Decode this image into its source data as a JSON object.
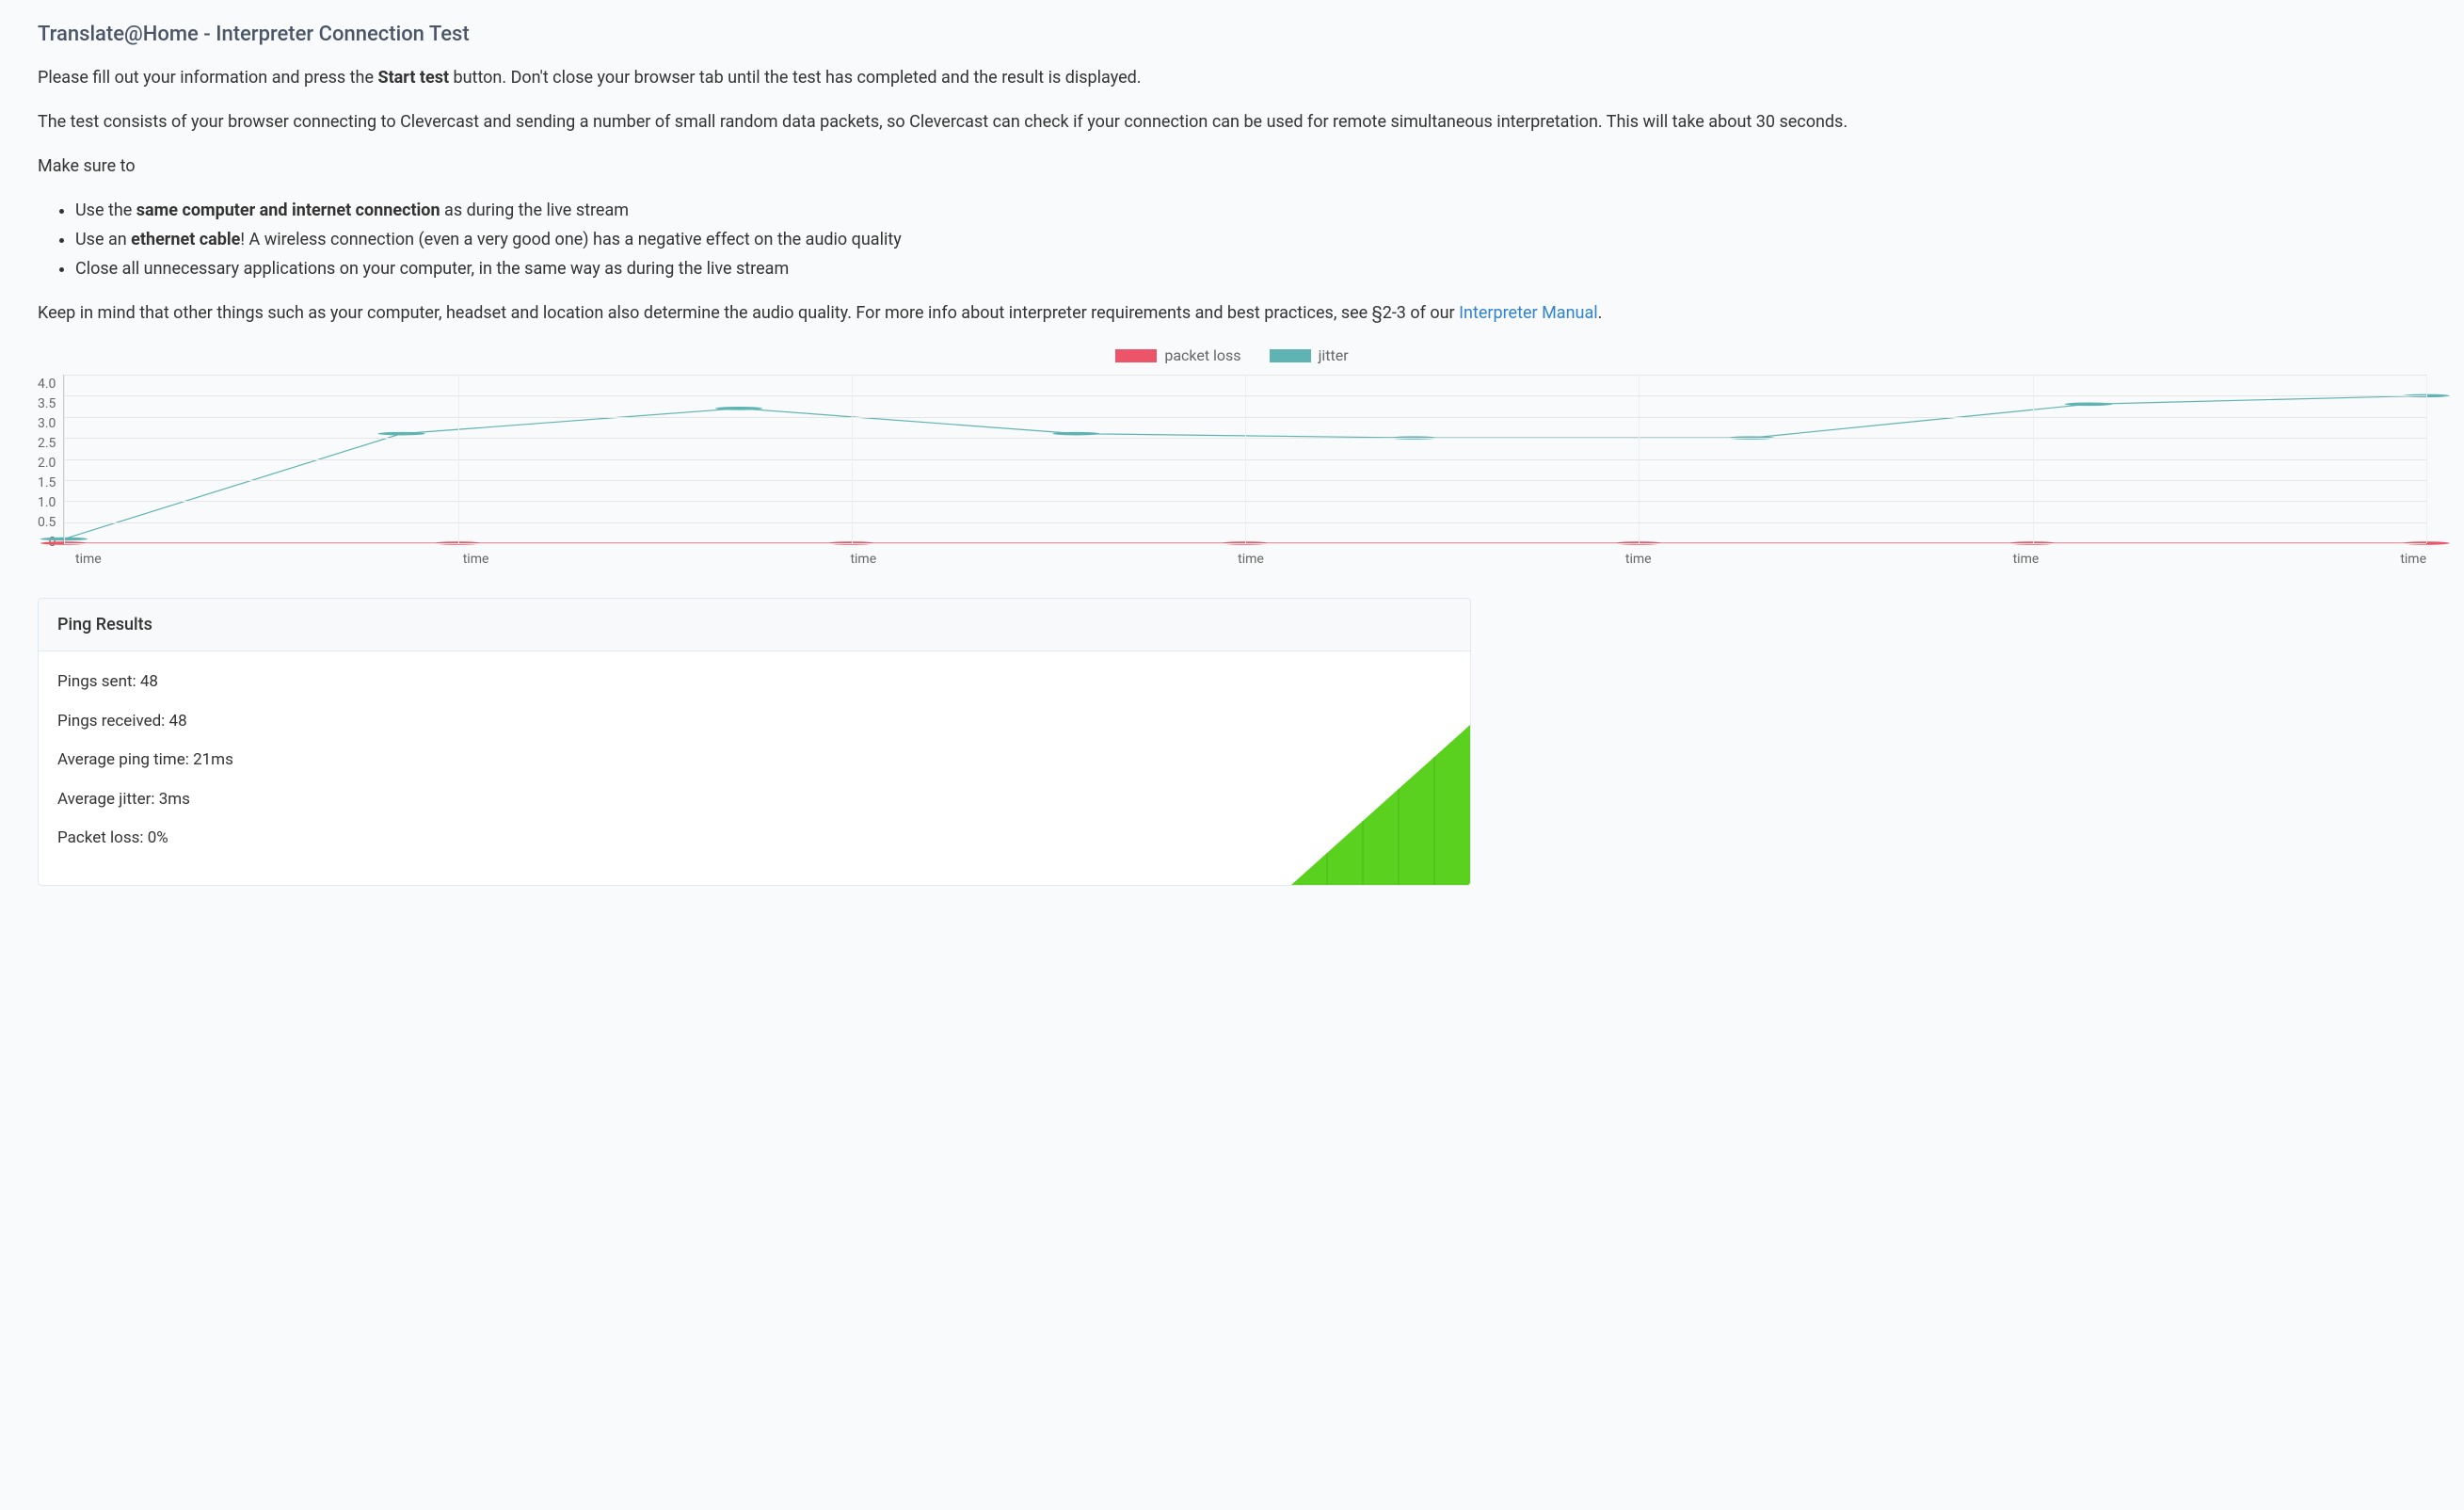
{
  "title": "Translate@Home - Interpreter Connection Test",
  "intro": {
    "p1_a": "Please fill out your information and press the ",
    "p1_bold": "Start test",
    "p1_b": " button. Don't close your browser tab until the test has completed and the result is displayed.",
    "p2": "The test consists of your browser connecting to Clevercast and sending a number of small random data packets, so Clevercast can check if your connection can be used for remote simultaneous interpretation. This will take about 30 seconds.",
    "p3": "Make sure to",
    "bullets": [
      {
        "pre": "Use the ",
        "bold": "same computer and internet connection",
        "post": " as during the live stream"
      },
      {
        "pre": "Use an ",
        "bold": "ethernet cable",
        "post": "! A wireless connection (even a very good one) has a negative effect on the audio quality"
      },
      {
        "pre": "",
        "bold": "",
        "post": "Close all unnecessary applications on your computer, in the same way as during the live stream"
      }
    ],
    "p4_a": "Keep in mind that other things such as your computer, headset and location also determine the audio quality. For more info about interpreter requirements and best practices, see §2-3 of our ",
    "p4_link": "Interpreter Manual",
    "p4_b": "."
  },
  "legend": {
    "packet_loss": "packet loss",
    "jitter": "jitter"
  },
  "chart_data": {
    "type": "line",
    "x_ticks": [
      "time",
      "time",
      "time",
      "time",
      "time",
      "time",
      "time"
    ],
    "y_ticks": [
      "4.0",
      "3.5",
      "3.0",
      "2.5",
      "2.0",
      "1.5",
      "1.0",
      "0.5",
      "0"
    ],
    "ylim": [
      0,
      4.0
    ],
    "xlabel": "time",
    "ylabel": "",
    "series": [
      {
        "name": "packet loss",
        "color": "#ec5569",
        "values": [
          0,
          0,
          0,
          0,
          0,
          0,
          0
        ]
      },
      {
        "name": "jitter",
        "color": "#5fb3b3",
        "values": [
          0.1,
          2.6,
          3.2,
          2.6,
          2.5,
          2.5,
          3.3,
          3.5
        ]
      }
    ]
  },
  "results": {
    "header": "Ping Results",
    "pings_sent_label": "Pings sent: ",
    "pings_sent": "48",
    "pings_received_label": "Pings received: ",
    "pings_received": "48",
    "avg_ping_label": "Average ping time: ",
    "avg_ping": "21ms",
    "avg_jitter_label": "Average jitter: ",
    "avg_jitter": "3ms",
    "packet_loss_label": "Packet loss: ",
    "packet_loss": "0%"
  },
  "colors": {
    "packet_loss": "#ec5569",
    "jitter": "#5fb3b3",
    "signal": "#5ad11f"
  }
}
